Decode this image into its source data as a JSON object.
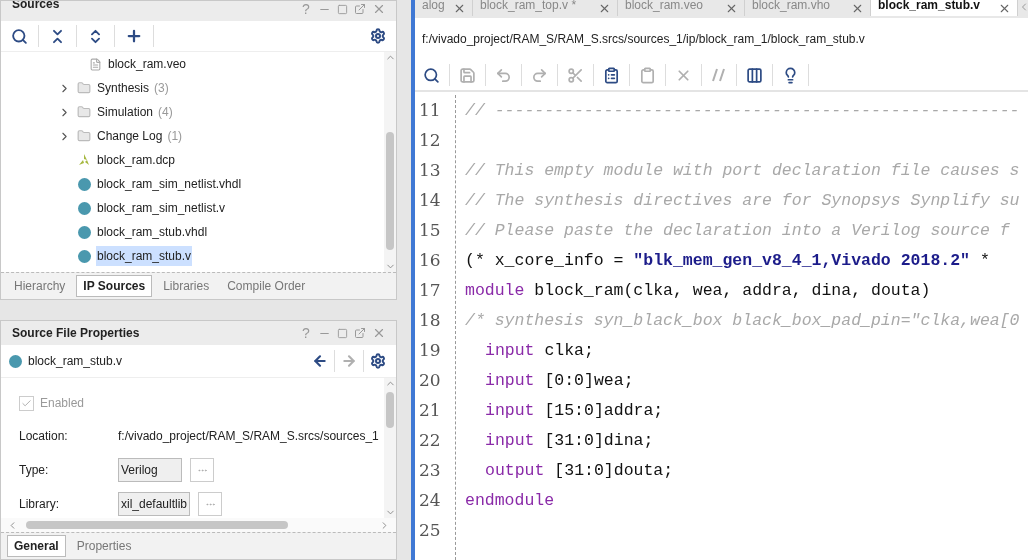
{
  "sources_panel": {
    "title": "Sources",
    "help": "?",
    "tree": [
      {
        "label": "block_ram.veo",
        "kind": "file"
      },
      {
        "label": "Synthesis",
        "count": "(3)",
        "kind": "folder",
        "expanded": false
      },
      {
        "label": "Simulation",
        "count": "(4)",
        "kind": "folder",
        "expanded": false
      },
      {
        "label": "Change Log",
        "count": "(1)",
        "kind": "folder",
        "expanded": false
      },
      {
        "label": "block_ram.dcp",
        "kind": "checkpoint",
        "selected": false
      },
      {
        "label": "block_ram_sim_netlist.vhdl",
        "kind": "ip",
        "selected": false
      },
      {
        "label": "block_ram_sim_netlist.v",
        "kind": "ip",
        "selected": false
      },
      {
        "label": "block_ram_stub.vhdl",
        "kind": "ip",
        "selected": false
      },
      {
        "label": "block_ram_stub.v",
        "kind": "ip",
        "selected": true
      }
    ],
    "tabs": [
      {
        "label": "Hierarchy",
        "selected": false
      },
      {
        "label": "IP Sources",
        "selected": true
      },
      {
        "label": "Libraries",
        "selected": false
      },
      {
        "label": "Compile Order",
        "selected": false
      }
    ]
  },
  "properties_panel": {
    "title": "Source File Properties",
    "help": "?",
    "file": "block_ram_stub.v",
    "enabled": {
      "label": "Enabled",
      "checked": true,
      "disabled": true
    },
    "fields": [
      {
        "label": "Location:",
        "value": "f:/vivado_project/RAM_S/RAM_S.srcs/sources_1",
        "kind": "text"
      },
      {
        "label": "Type:",
        "value": "Verilog",
        "kind": "choice"
      },
      {
        "label": "Library:",
        "value": "xil_defaultlib",
        "kind": "choice"
      }
    ],
    "tabs": [
      {
        "label": "General",
        "selected": true
      },
      {
        "label": "Properties",
        "selected": false
      }
    ]
  },
  "editor": {
    "tabs": [
      {
        "label": "alog",
        "selected": false
      },
      {
        "label": "block_ram_top.v *",
        "selected": false
      },
      {
        "label": "block_ram.veo",
        "selected": false
      },
      {
        "label": "block_ram.vho",
        "selected": false
      },
      {
        "label": "block_ram_stub.v",
        "selected": true
      }
    ],
    "path": "f:/vivado_project/RAM_S/RAM_S.srcs/sources_1/ip/block_ram_1/block_ram_stub.v",
    "toolbar": [
      {
        "kind": "search",
        "disabled": false
      },
      {
        "kind": "save",
        "disabled": true
      },
      {
        "kind": "undo",
        "disabled": true
      },
      {
        "kind": "redo",
        "disabled": true
      },
      {
        "kind": "cut",
        "disabled": true
      },
      {
        "kind": "copy",
        "disabled": false
      },
      {
        "kind": "paste",
        "disabled": true
      },
      {
        "kind": "delete",
        "disabled": true
      },
      {
        "kind": "comment",
        "disabled": true
      },
      {
        "kind": "columns",
        "disabled": false
      },
      {
        "kind": "hint",
        "disabled": false
      }
    ],
    "lines": [
      {
        "number": "11",
        "tokens": [
          {
            "kind": "comment",
            "text": "// -----------------------------------------------------"
          }
        ]
      },
      {
        "number": "12"
      },
      {
        "number": "13",
        "tokens": [
          {
            "kind": "comment",
            "text": "// This empty module with port declaration file causes s"
          }
        ]
      },
      {
        "number": "14",
        "tokens": [
          {
            "kind": "comment",
            "text": "// The synthesis directives are for Synopsys Synplify su"
          }
        ]
      },
      {
        "number": "15",
        "tokens": [
          {
            "kind": "comment",
            "text": "// Please paste the declaration into a Verilog source f"
          }
        ]
      },
      {
        "number": "16",
        "tokens": [
          {
            "kind": "plain",
            "text": "(* x_core_info = "
          },
          {
            "kind": "string",
            "text": "\"blk_mem_gen_v8_4_1,Vivado 2018.2\""
          },
          {
            "kind": "plain",
            "text": " *"
          }
        ]
      },
      {
        "number": "17",
        "tokens": [
          {
            "kind": "keyword",
            "text": "module"
          },
          {
            "kind": "plain",
            "text": " block_ram(clka, wea, addra, dina, douta)"
          }
        ]
      },
      {
        "number": "18",
        "tokens": [
          {
            "kind": "comment",
            "text": "/* synthesis syn_black_box black_box_pad_pin=\"clka,wea[0"
          }
        ]
      },
      {
        "number": "19",
        "indent": true,
        "tokens": [
          {
            "kind": "keyword",
            "text": "input"
          },
          {
            "kind": "plain",
            "text": " clka;"
          }
        ]
      },
      {
        "number": "20",
        "indent": true,
        "tokens": [
          {
            "kind": "keyword",
            "text": "input"
          },
          {
            "kind": "plain",
            "text": " [0:0]wea;"
          }
        ]
      },
      {
        "number": "21",
        "indent": true,
        "tokens": [
          {
            "kind": "keyword",
            "text": "input"
          },
          {
            "kind": "plain",
            "text": " [15:0]addra;"
          }
        ]
      },
      {
        "number": "22",
        "indent": true,
        "tokens": [
          {
            "kind": "keyword",
            "text": "input"
          },
          {
            "kind": "plain",
            "text": " [31:0]dina;"
          }
        ]
      },
      {
        "number": "23",
        "indent": true,
        "tokens": [
          {
            "kind": "keyword",
            "text": "output"
          },
          {
            "kind": "plain",
            "text": " [31:0]douta;"
          }
        ]
      },
      {
        "number": "24",
        "tokens": [
          {
            "kind": "keyword",
            "text": "endmodule"
          }
        ]
      },
      {
        "number": "25"
      }
    ]
  }
}
